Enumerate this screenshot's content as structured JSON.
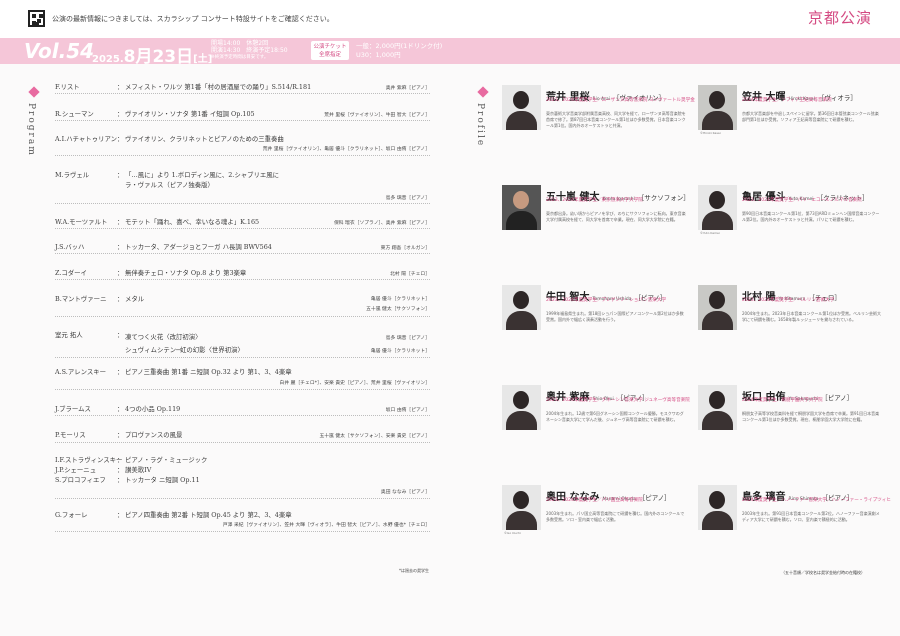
{
  "header": {
    "notice": "公演の最新情報につきましては、スカラシップ コンサート特設サイトをご確認ください。",
    "city": "京都公演"
  },
  "banner": {
    "vol": "Vol.54",
    "year": "2025.",
    "month_day": "8月23日",
    "weekday": "[土]",
    "times": [
      "開場14:00　休憩2回",
      "開演14:30　終演予定18:50"
    ],
    "times_note": "※終演予定時間は目安です。",
    "badge": [
      "公演チケット",
      "全席指定"
    ],
    "price": [
      "一般：2,000円(1ドリンク付)",
      "U30：1,000円"
    ]
  },
  "program": {
    "label": "Program",
    "items": [
      {
        "composer": "F.リスト",
        "title": "メフィスト・ワルツ 第1番「村の居酒屋での踊り」S.514/R.181",
        "performers": "奥井 紫麻［ピアノ］"
      },
      {
        "composer": "R.シューマン",
        "title": "ヴァイオリン・ソナタ 第1番 イ短調 Op.105",
        "performers": "荒井 里桜［ヴァイオリン］、牛田 智大［ピアノ］"
      },
      {
        "composer": "A.I.ハチャトゥリアン",
        "title": "ヴァイオリン、クラリネットとピアノのための三重奏曲",
        "performers": "荒井 里桜［ヴァイオリン］、亀居 優斗［クラリネット］、坂口 由侑［ピアノ］"
      },
      {
        "composer": "M.ラヴェル",
        "title_lines": [
          "「…風に」より 1.ボロディン風に、2.シャブリエ風に",
          "ラ・ヴァルス（ピアノ独奏版）"
        ],
        "performers": "島多 璃音［ピアノ］"
      },
      {
        "composer": "W.A.モーツァルト",
        "title": "モテット「踊れ、喜べ、幸いなる魂よ」K.165",
        "performers": "保科 瑠衣［ソプラノ］、奥井 紫麻［ピアノ］"
      },
      {
        "composer": "J.S.バッハ",
        "title": "トッカータ、アダージョとフーガ ハ長調 BWV564",
        "performers": "東方 翔吾［オルガン］"
      },
      {
        "composer": "Z.コダーイ",
        "title": "無伴奏チェロ・ソナタ Op.8 より 第3楽章",
        "performers": "北村 陽［チェロ］"
      },
      {
        "composer": "B.マントヴァーニ",
        "title": "メタル",
        "performers_lines": [
          "亀居 優斗［クラリネット］",
          "五十嵐 健太［サクソフォン］"
        ]
      },
      {
        "composer": "室元 拓人",
        "title_lines": [
          "凍てつく火花〈改訂初演〉",
          "シュヴィムシテン─虹の幻影〈世界初演〉"
        ],
        "performers_lines": [
          "島多 璃音［ピアノ］",
          "亀居 優斗［クラリネット］"
        ]
      },
      {
        "composer": "A.S.アレンスキー",
        "title": "ピアノ三重奏曲 第1番 ニ短調 Op.32 より 第1、3、4楽章",
        "performers": "白井 麗［チェロ*］、安楽 貴史［ピアノ］、荒井 里桜［ヴァイオリン］"
      },
      {
        "composer": "J.ブラームス",
        "title": "4つの小品 Op.119",
        "performers": "坂口 由侑［ピアノ］"
      },
      {
        "composer": "P.モーリス",
        "title": "プロヴァンスの風景",
        "performers": "五十嵐 健太［サクソフォン］、安楽 貴史［ピアノ］"
      },
      {
        "composer_lines": [
          "I.F.ストラヴィンスキー",
          "J.P.シェーニュ",
          "S.プロコフィエフ"
        ],
        "title_lines": [
          "ピアノ・ラグ・ミュージック",
          "讃美歌IV",
          "トッカータ ニ短調 Op.11"
        ],
        "performers": "奥田 ななみ［ピアノ］"
      },
      {
        "composer": "G.フォーレ",
        "title": "ピアノ四重奏曲 第2番 ト短調 Op.45 より 第2、3、4楽章",
        "performers": "戸澤 采紀［ヴァイオリン］、笠井 大暉［ヴィオラ］、牛田 智大［ピアノ］、水野 優也*［チェロ］"
      }
    ],
    "note": "*は過去の奨学生"
  },
  "profile": {
    "label": "Profile",
    "artists": [
      {
        "name": "荒井 里桜",
        "roman": "Rio Arai",
        "inst": "［ヴァイオリン］",
        "award": "2023、2024年度奨学生／ローザンヌ高等音楽院 ヨンヴァートル奨学金",
        "bio": "東京藝術大学音楽学部附属音楽高校、同大学を経て、ローザンヌ高等音楽院を首席で修了。第87回日本音楽コンクール第1位ほか多数受賞。日本音楽コンクール第1位。国内外のオーケストラと共演。",
        "caption": ""
      },
      {
        "name": "笠井 大暉",
        "roman": "Hiroki Kasai",
        "inst": "［ヴィオラ］",
        "award": "2024年度奨学生／ソフィア王妃高等音楽院",
        "bio": "京都大学音楽部を中退しスペインに留学。第36回日本管弦楽コンクール弦楽部門第1位ほか受賞。ソフィア王妃高等音楽院にて研鑽を積む。",
        "caption": "©Hiroki Kasai"
      },
      {
        "name": "五十嵐 健太",
        "roman": "Kenta Igarashi",
        "inst": "［サクソフォン］",
        "award": "2023、2024年度奨学生／東京音楽大学大学院",
        "bio": "東京都出身。幼い頃からピアノを学び、のちにサクソフォンに転向。東京音楽大学付属高校を経て、同大学を首席で卒業。現在、同大学大学院に在籍。",
        "caption": ""
      },
      {
        "name": "亀居 優斗",
        "roman": "Yuto Kamei",
        "inst": "［クラリネット］",
        "award": "2023、2024年度奨学生／パリ・エコールノルマル音楽院",
        "bio": "第90回日本音楽コンクール第1位、第73回ARDミュンヘン国際音楽コンクール第2位。国内外のオーケストラと共演。パリにて研鑽を積む。",
        "caption": "©Yuto Kamei"
      },
      {
        "name": "牛田 智大",
        "roman": "Tomoharu Ushida",
        "inst": "［ピアノ］",
        "award": "2023、2024年度奨学生／ブレゲンツ・ショパン音楽大学",
        "bio": "1999年福島県生まれ。第18回ショパン国際ピアノコンクール第2位ほか多数受賞。国内外で幅広く演奏活動を行う。",
        "caption": ""
      },
      {
        "name": "北村 陽",
        "roman": "Yo Kitamura",
        "inst": "［チェロ］",
        "award": "2023、2024年度奨学生／ベルリン芸術大学",
        "bio": "2004年生まれ。2023年日本音楽コンクール第1位ほか受賞。ベルリン芸術大学にて研鑽を積む。1658年製ルッジェーリを貸与されている。",
        "caption": ""
      },
      {
        "name": "奥井 紫麻",
        "roman": "Shio Okui",
        "inst": "［ピアノ］",
        "award": "2023、2024年度奨学生／グネーシン音楽大学 ジュネーヴ高等音楽院",
        "bio": "2004年生まれ。12歳で第6回グネーシン国際コンクール優勝。モスクワのグネーシン音楽大学にて学んだ後、ジュネーヴ高等音楽院にて研鑽を積む。",
        "caption": ""
      },
      {
        "name": "坂口 由侑",
        "roman": "Yu Sakaguchi",
        "inst": "［ピアノ］",
        "award": "2024年度奨学生／桐朋学園大学大学院",
        "bio": "桐朋女子高等学校音楽科を経て桐朋学園大学を首席で卒業。第91回日本音楽コンクール第1位ほか多数受賞。現在、桐朋学園大学大学院に在籍。",
        "caption": ""
      },
      {
        "name": "奥田 ななみ",
        "roman": "Nanami Okuda",
        "inst": "［ピアノ］",
        "award": "2023、2024年度奨学生／パリ国立高等音楽院",
        "bio": "2003年生まれ。パリ国立高等音楽院にて研鑽を積む。国内外のコンクールで多数受賞。ソロ・室内楽で幅広く活動。",
        "caption": "©Go Ouchi"
      },
      {
        "name": "島多 璃音",
        "roman": "Rino Shimata",
        "inst": "［ピアノ］",
        "award": "2024年度奨学生／ハノーファー音楽大学／ハノーファー・ライプツィヒ",
        "bio": "2003年生まれ。第91回日本音楽コンクール第2位。ハノーファー音楽演劇メディア大学にて研鑽を積む。ソロ、室内楽で積極的に活動。",
        "caption": ""
      }
    ],
    "footnote": "（五十音順／学校名は奨学金給付時の在籍校）"
  },
  "colors": {
    "accent": "#d44a82",
    "band": "#f5c6d8"
  }
}
